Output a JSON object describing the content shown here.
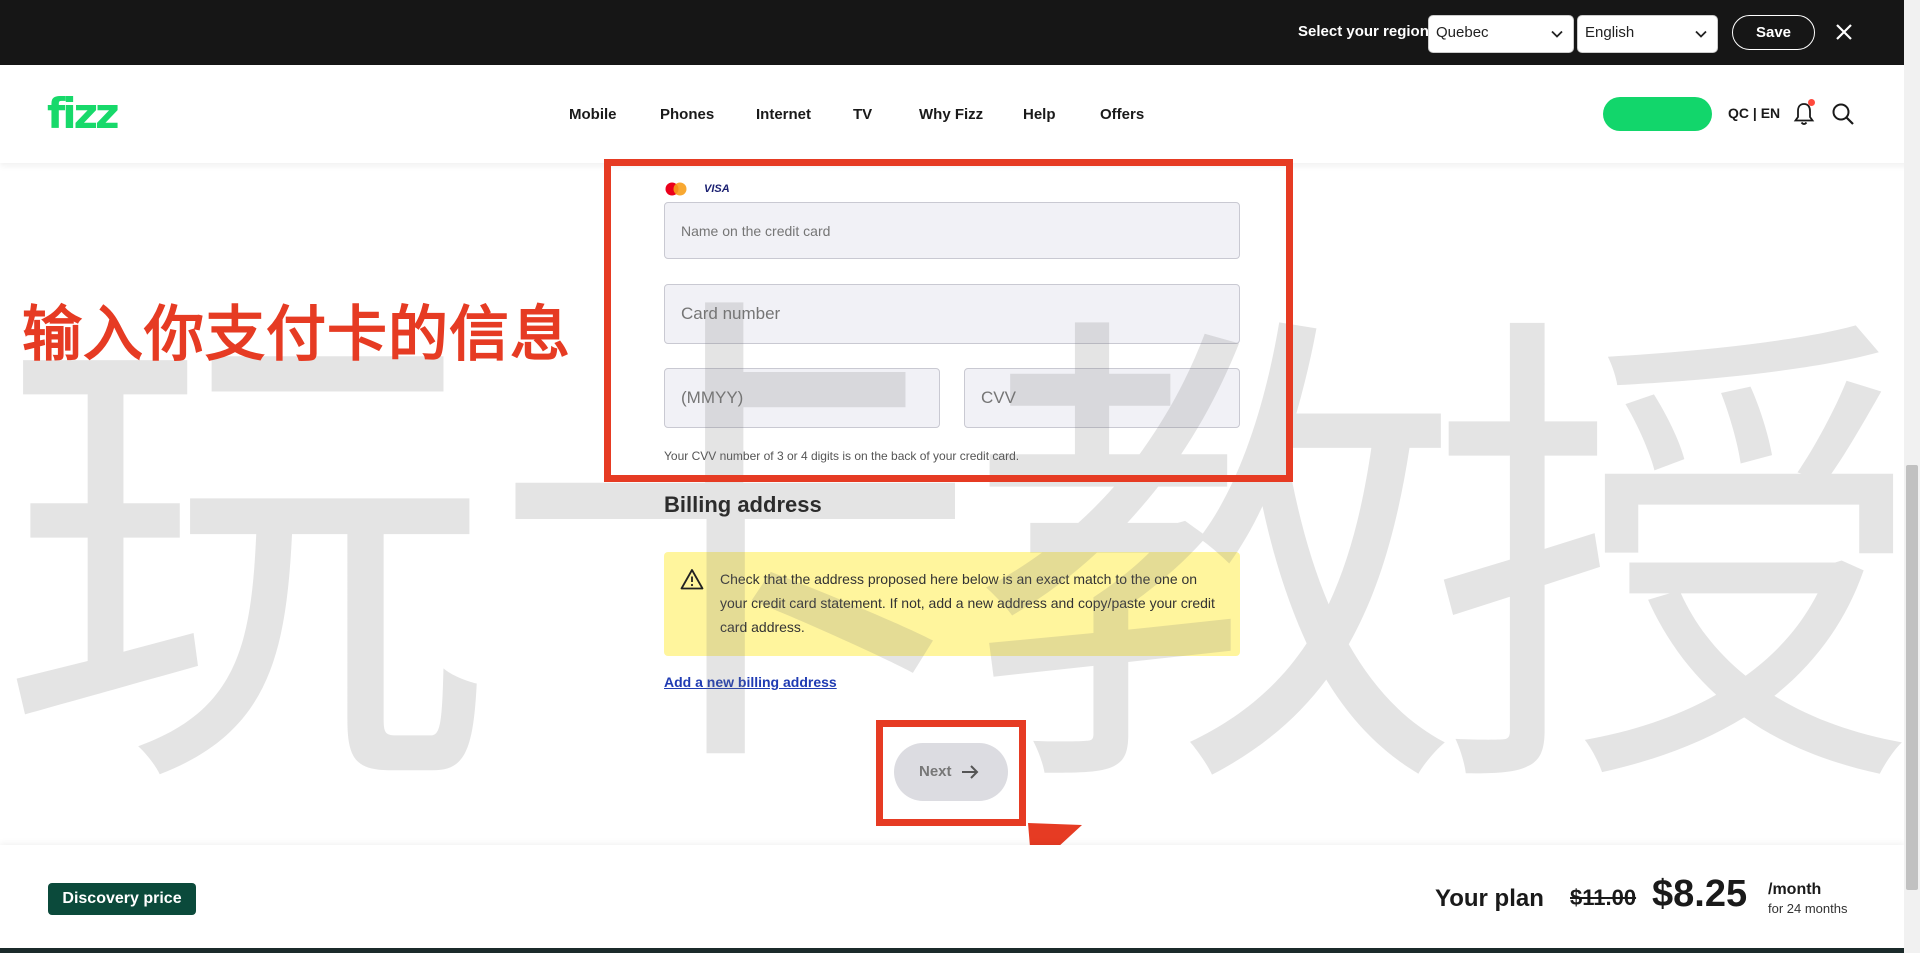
{
  "region_bar": {
    "label": "Select your region",
    "region_value": "Quebec",
    "language_value": "English",
    "save_label": "Save"
  },
  "nav": {
    "logo": "fizz",
    "links": [
      "Mobile",
      "Phones",
      "Internet",
      "TV",
      "Why Fizz",
      "Help",
      "Offers"
    ],
    "lang": "QC | EN"
  },
  "payment": {
    "card_brand_visa": "VISA",
    "name_placeholder": "Name on the credit card",
    "card_number_placeholder": "Card number",
    "expiry_placeholder": "(MMYY)",
    "cvv_placeholder": "CVV",
    "cvv_hint": "Your CVV number of 3 or 4 digits is on the back of your credit card."
  },
  "billing": {
    "title": "Billing address",
    "notice": "Check that the address proposed here below is an exact match to the one on your credit card statement. If not, add a new address and copy/paste your credit card address.",
    "add_link": "Add a new billing address",
    "next_label": "Next"
  },
  "annotation": {
    "text": "输入你支付卡的信息",
    "watermark": [
      "玩",
      "卡",
      "教",
      "授"
    ]
  },
  "plan": {
    "badge": "Discovery price",
    "label": "Your plan",
    "old_price": "$11.00",
    "new_price": "$8.25",
    "per": "/month",
    "term": "for 24 months"
  },
  "colors": {
    "brand_green": "#17d96a",
    "annotation_red": "#e63b23",
    "notice_yellow": "#fff59d",
    "badge_dark_green": "#0b4a3b"
  }
}
